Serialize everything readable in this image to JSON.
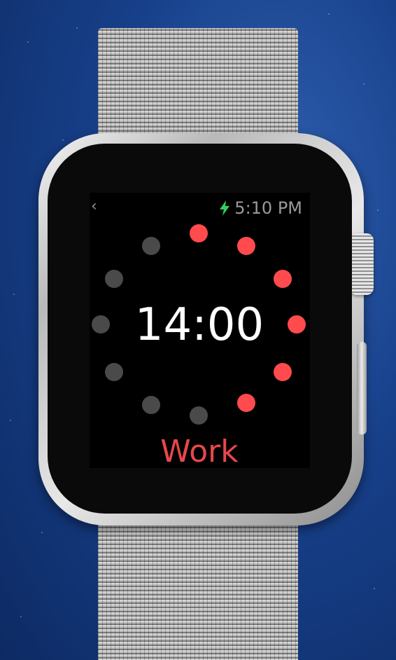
{
  "status": {
    "time": "5:10 PM"
  },
  "timer": {
    "value": "14:00",
    "label": "Work"
  },
  "colors": {
    "active": "#ff4a4e",
    "inactive": "#4a4a4a",
    "label": "#e8474b",
    "bolt": "#31d158"
  },
  "icons": {
    "back": "chevron-left-icon",
    "battery": "charging-bolt-icon"
  },
  "ring": {
    "total_dots": 12,
    "active_dots": 6
  }
}
